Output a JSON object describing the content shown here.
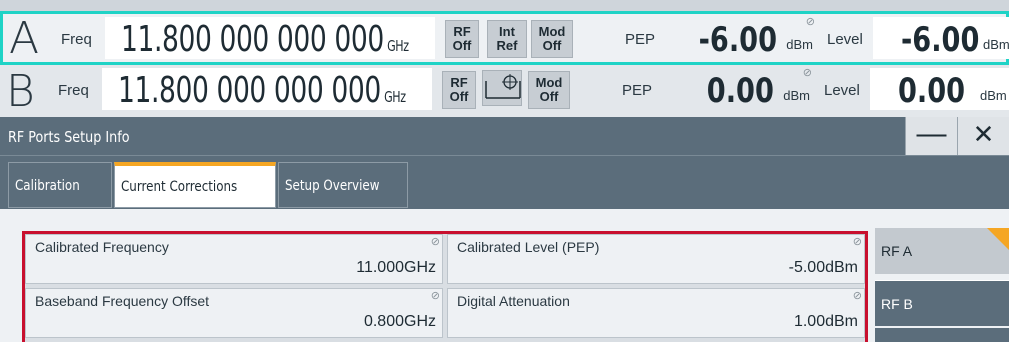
{
  "rows": {
    "a": {
      "letter": "A",
      "freq_label": "Freq",
      "freq_value": "11.800 000 000 000",
      "freq_unit": "GHz",
      "rf_btn": [
        "RF",
        "Off"
      ],
      "ref_btn": [
        "Int",
        "Ref"
      ],
      "mod_btn": [
        "Mod",
        "Off"
      ],
      "pep_label": "PEP",
      "pep_value": "-6.00",
      "pep_unit": "dBm",
      "level_label": "Level",
      "level_value": "-6.00",
      "level_unit": "dBm"
    },
    "b": {
      "letter": "B",
      "freq_label": "Freq",
      "freq_value": "11.800 000 000 000",
      "freq_unit": "GHz",
      "rf_btn": [
        "RF",
        "Off"
      ],
      "mod_btn": [
        "Mod",
        "Off"
      ],
      "pep_label": "PEP",
      "pep_value": "0.00",
      "pep_unit": "dBm",
      "level_label": "Level",
      "level_value": "0.00",
      "level_unit": "dBm"
    }
  },
  "dialog": {
    "title": "RF Ports Setup Info",
    "minimize": "—",
    "close": "✕"
  },
  "tabs": [
    {
      "label": "Calibration"
    },
    {
      "label": "Current Corrections"
    },
    {
      "label": "Setup Overview"
    }
  ],
  "fields": [
    {
      "label": "Calibrated Frequency",
      "value": "11.000GHz"
    },
    {
      "label": "Calibrated Level (PEP)",
      "value": "-5.00dBm"
    },
    {
      "label": "Baseband Frequency Offset",
      "value": "0.800GHz"
    },
    {
      "label": "Digital Attenuation",
      "value": "1.00dBm"
    }
  ],
  "side_items": [
    {
      "label": "RF A"
    },
    {
      "label": "RF B"
    }
  ],
  "colors": {
    "highlight_border": "#1fd3c6",
    "panel_border": "#c8102e",
    "accent": "#f5a623",
    "title_bg": "#5b6d7b"
  }
}
